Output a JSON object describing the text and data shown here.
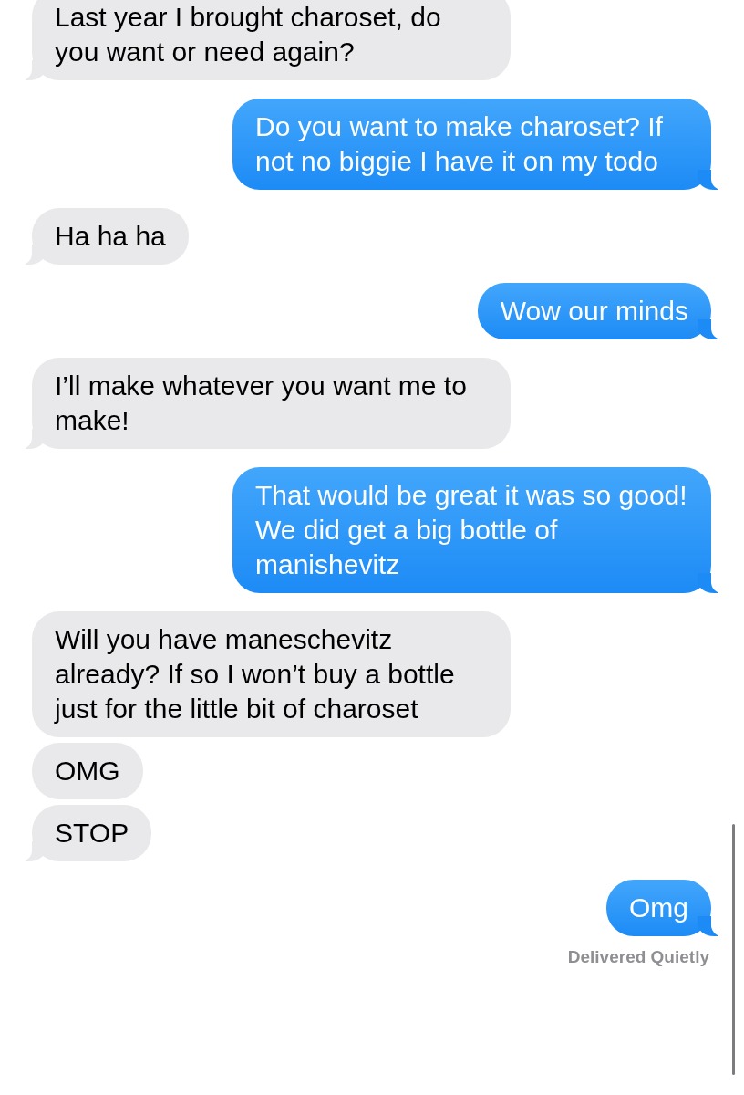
{
  "messages": [
    {
      "outgoing": false,
      "text": "Last year I brought charoset, do you want or need again?",
      "tail": true
    },
    {
      "outgoing": true,
      "text": "Do you want to make charoset? If not no biggie I have it on my todo",
      "tail": true
    },
    {
      "outgoing": false,
      "text": "Ha ha ha",
      "tail": true
    },
    {
      "outgoing": true,
      "text": "Wow our minds",
      "tail": true
    },
    {
      "outgoing": false,
      "text": "I’ll make whatever you want me to make!",
      "tail": true
    },
    {
      "outgoing": true,
      "text": "That would be great it was so good! We did get a big bottle of manishevitz",
      "tail": true
    },
    {
      "outgoing": false,
      "text": "Will you have maneschevitz already? If so I won’t buy a bottle just for the little bit of charoset",
      "tail": false
    },
    {
      "outgoing": false,
      "text": "OMG",
      "tail": false
    },
    {
      "outgoing": false,
      "text": "STOP",
      "tail": true
    },
    {
      "outgoing": true,
      "text": "Omg",
      "tail": true
    }
  ],
  "status": "Delivered Quietly"
}
